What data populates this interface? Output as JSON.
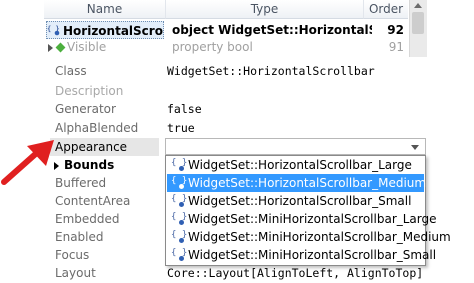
{
  "top_list": {
    "headers": {
      "name": "Name",
      "type": "Type",
      "order": "Order"
    },
    "rows": [
      {
        "name": "HorizontalScrollbar",
        "type": "object WidgetSet::HorizontalScrollbar",
        "order": "92"
      },
      {
        "name": "Visible",
        "type": "property bool",
        "order": "91"
      }
    ]
  },
  "properties": [
    {
      "label": "Class",
      "value": "WidgetSet::HorizontalScrollbar"
    },
    {
      "label": "Description",
      "value": ""
    },
    {
      "label": "Generator",
      "value": "false"
    },
    {
      "label": "AlphaBlended",
      "value": "true"
    },
    {
      "label": "Appearance",
      "value": ""
    },
    {
      "label": "Bounds",
      "value": ""
    },
    {
      "label": "Buffered",
      "value": ""
    },
    {
      "label": "ContentArea",
      "value": ""
    },
    {
      "label": "Embedded",
      "value": ""
    },
    {
      "label": "Enabled",
      "value": ""
    },
    {
      "label": "Focus",
      "value": ""
    },
    {
      "label": "Layout",
      "value": "Core::Layout[AlignToLeft, AlignToTop]"
    }
  ],
  "dropdown": {
    "options": [
      "WidgetSet::HorizontalScrollbar_Large",
      "WidgetSet::HorizontalScrollbar_Medium",
      "WidgetSet::HorizontalScrollbar_Small",
      "WidgetSet::MiniHorizontalScrollbar_Large",
      "WidgetSet::MiniHorizontalScrollbar_Medium",
      "WidgetSet::MiniHorizontalScrollbar_Small"
    ],
    "selected": "WidgetSet::HorizontalScrollbar_Medium"
  },
  "colors": {
    "selection": "#3399ff",
    "arrow": "#e02020",
    "row_highlight": "#e3eefa"
  }
}
